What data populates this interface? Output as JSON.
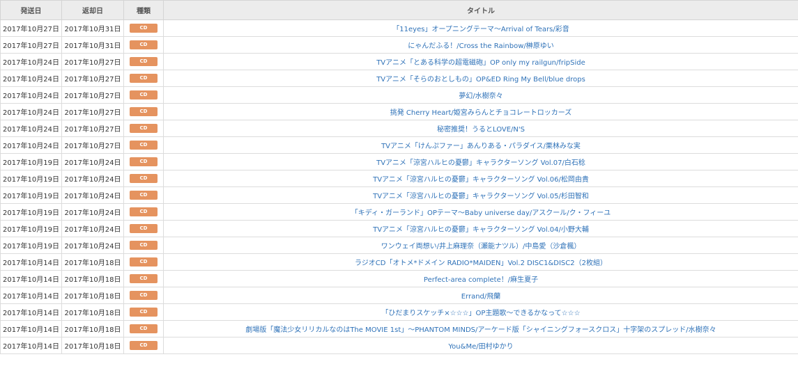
{
  "headers": {
    "send_date": "発送日",
    "return_date": "返却日",
    "type": "種類",
    "title": "タイトル"
  },
  "colors": {
    "badge_bg": "#e5935f",
    "link": "#2f72b8",
    "header_bg": "#ececec"
  },
  "rows": [
    {
      "send": "2017年10月27日",
      "ret": "2017年10月31日",
      "type": "CD",
      "title": "「11eyes」オープニングテーマ～Arrival of Tears/彩音"
    },
    {
      "send": "2017年10月27日",
      "ret": "2017年10月31日",
      "type": "CD",
      "title": "にゃんだふる！/Cross the Rainbow/榊原ゆい"
    },
    {
      "send": "2017年10月24日",
      "ret": "2017年10月27日",
      "type": "CD",
      "title": "TVアニメ「とある科学の超電磁砲」OP only my railgun/fripSide"
    },
    {
      "send": "2017年10月24日",
      "ret": "2017年10月27日",
      "type": "CD",
      "title": "TVアニメ「そらのおとしもの」OP&ED Ring My Bell/blue drops"
    },
    {
      "send": "2017年10月24日",
      "ret": "2017年10月27日",
      "type": "CD",
      "title": "夢幻/水樹奈々"
    },
    {
      "send": "2017年10月24日",
      "ret": "2017年10月27日",
      "type": "CD",
      "title": "挑発 Cherry Heart/姫宮みらんとチョコレートロッカーズ"
    },
    {
      "send": "2017年10月24日",
      "ret": "2017年10月27日",
      "type": "CD",
      "title": "秘密推奨！うるとLOVE/N'S"
    },
    {
      "send": "2017年10月24日",
      "ret": "2017年10月27日",
      "type": "CD",
      "title": "TVアニメ「けんぷファー」あんりある・パラダイス/栗林みな実"
    },
    {
      "send": "2017年10月19日",
      "ret": "2017年10月24日",
      "type": "CD",
      "title": "TVアニメ「涼宮ハルヒの憂鬱」キャラクターソング Vol.07/白石稔"
    },
    {
      "send": "2017年10月19日",
      "ret": "2017年10月24日",
      "type": "CD",
      "title": "TVアニメ「涼宮ハルヒの憂鬱」キャラクターソング Vol.06/松岡由貴"
    },
    {
      "send": "2017年10月19日",
      "ret": "2017年10月24日",
      "type": "CD",
      "title": "TVアニメ「涼宮ハルヒの憂鬱」キャラクターソング Vol.05/杉田智和"
    },
    {
      "send": "2017年10月19日",
      "ret": "2017年10月24日",
      "type": "CD",
      "title": "「キディ・ガーランド」OPテーマ～Baby universe day/アスクール/ク・フィーユ"
    },
    {
      "send": "2017年10月19日",
      "ret": "2017年10月24日",
      "type": "CD",
      "title": "TVアニメ「涼宮ハルヒの憂鬱」キャラクターソング Vol.04/小野大輔"
    },
    {
      "send": "2017年10月19日",
      "ret": "2017年10月24日",
      "type": "CD",
      "title": "ワンウェイ両想い/井上麻理奈（瀬能ナツル）/中島愛（沙倉楓）"
    },
    {
      "send": "2017年10月14日",
      "ret": "2017年10月18日",
      "type": "CD",
      "title": "ラジオCD「オトメ*ドメイン RADIO*MAIDEN」Vol.2 DISC1&DISC2（2枚組）"
    },
    {
      "send": "2017年10月14日",
      "ret": "2017年10月18日",
      "type": "CD",
      "title": "Perfect-area complete！/麻生夏子"
    },
    {
      "send": "2017年10月14日",
      "ret": "2017年10月18日",
      "type": "CD",
      "title": "Errand/飛蘭"
    },
    {
      "send": "2017年10月14日",
      "ret": "2017年10月18日",
      "type": "CD",
      "title": "「ひだまりスケッチ×☆☆☆」OP主題歌～できるかなって☆☆☆"
    },
    {
      "send": "2017年10月14日",
      "ret": "2017年10月18日",
      "type": "CD",
      "title": "劇場版「魔法少女リリカルなのはThe MOVIE 1st」～PHANTOM MINDS/アーケード版「シャイニングフォースクロス」十字架のスプレッド/水樹奈々"
    },
    {
      "send": "2017年10月14日",
      "ret": "2017年10月18日",
      "type": "CD",
      "title": "You&Me/田村ゆかり"
    }
  ]
}
